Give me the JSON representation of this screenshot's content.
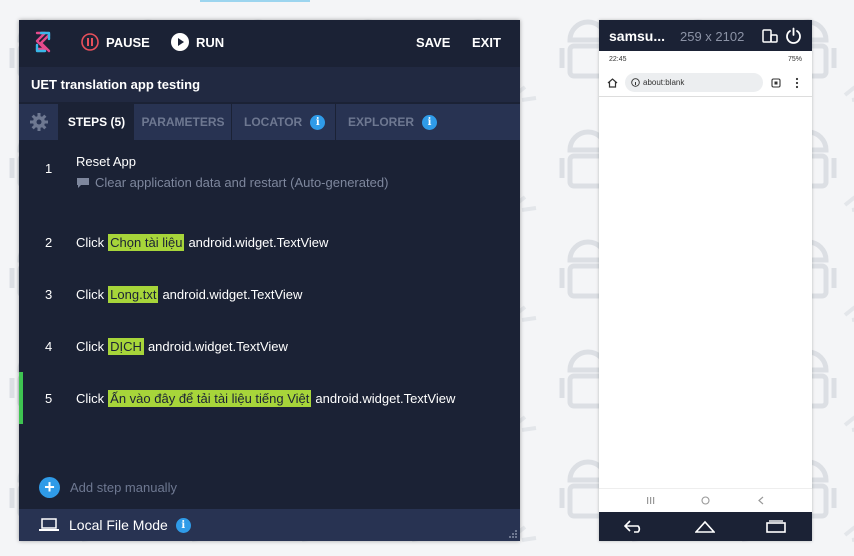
{
  "toolbar": {
    "pause_label": "PAUSE",
    "run_label": "RUN",
    "save_label": "SAVE",
    "exit_label": "EXIT"
  },
  "project": {
    "title": "UET translation app testing"
  },
  "tabs": [
    {
      "label": "STEPS (5)",
      "active": true
    },
    {
      "label": "PARAMETERS",
      "active": false
    },
    {
      "label": "LOCATOR",
      "active": false
    },
    {
      "label": "EXPLORER",
      "active": false
    }
  ],
  "steps": [
    {
      "num": "1",
      "action": "Reset App",
      "subtitle": "Clear application data and restart (Auto-generated)"
    },
    {
      "num": "2",
      "action": "Click",
      "target": "Chọn tài liệu",
      "element": "android.widget.TextView"
    },
    {
      "num": "3",
      "action": "Click",
      "target": "Long.txt",
      "element": "android.widget.TextView"
    },
    {
      "num": "4",
      "action": "Click",
      "target": "DỊCH",
      "element": "android.widget.TextView"
    },
    {
      "num": "5",
      "action": "Click",
      "target": "Ấn vào đây để tải tài liệu tiếng Việt",
      "element": "android.widget.TextView",
      "active": true
    }
  ],
  "add_step_label": "Add step manually",
  "footer": {
    "mode_label": "Local File Mode"
  },
  "device": {
    "name": "samsu...",
    "resolution": "259 x 2102",
    "status_time": "22:45",
    "status_battery": "75%",
    "url": "about:blank"
  },
  "colors": {
    "panel_bg": "#1b2235",
    "tab_bar_bg": "#283352",
    "highlight": "#a7d53a",
    "active_step_bar": "#3ec451",
    "info_blue": "#2f9be8"
  }
}
